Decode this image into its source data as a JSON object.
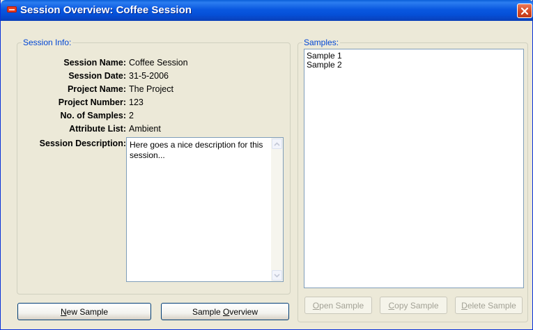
{
  "window": {
    "title": "Session Overview: Coffee Session",
    "icon": "app-icon",
    "close_icon": "close-icon"
  },
  "session_info": {
    "group_title": "Session Info:",
    "fields": [
      {
        "label": "Session Name:",
        "value": "Coffee Session"
      },
      {
        "label": "Session Date:",
        "value": "31-5-2006"
      },
      {
        "label": "Project Name:",
        "value": "The Project"
      },
      {
        "label": "Project Number:",
        "value": "123"
      },
      {
        "label": "No. of Samples:",
        "value": "2"
      },
      {
        "label": "Attribute List:",
        "value": "Ambient"
      }
    ],
    "description_label": "Session Description:",
    "description_value": "Here goes a nice description for this session..."
  },
  "samples": {
    "group_title": "Samples:",
    "items": [
      "Sample 1",
      "Sample 2"
    ]
  },
  "buttons": {
    "new_sample": {
      "pre": "",
      "key": "N",
      "post": "ew Sample"
    },
    "sample_overview": {
      "pre": "Sample ",
      "key": "O",
      "post": "verview"
    },
    "open_sample": {
      "pre": "",
      "key": "O",
      "post": "pen Sample"
    },
    "copy_sample": {
      "pre": "",
      "key": "C",
      "post": "opy Sample"
    },
    "delete_sample": {
      "pre": "",
      "key": "D",
      "post": "elete Sample"
    }
  },
  "colors": {
    "title_bar": "#0a58e0",
    "group_title": "#0046d5",
    "window_bg": "#ece9d8",
    "close_button": "#d64a24"
  }
}
